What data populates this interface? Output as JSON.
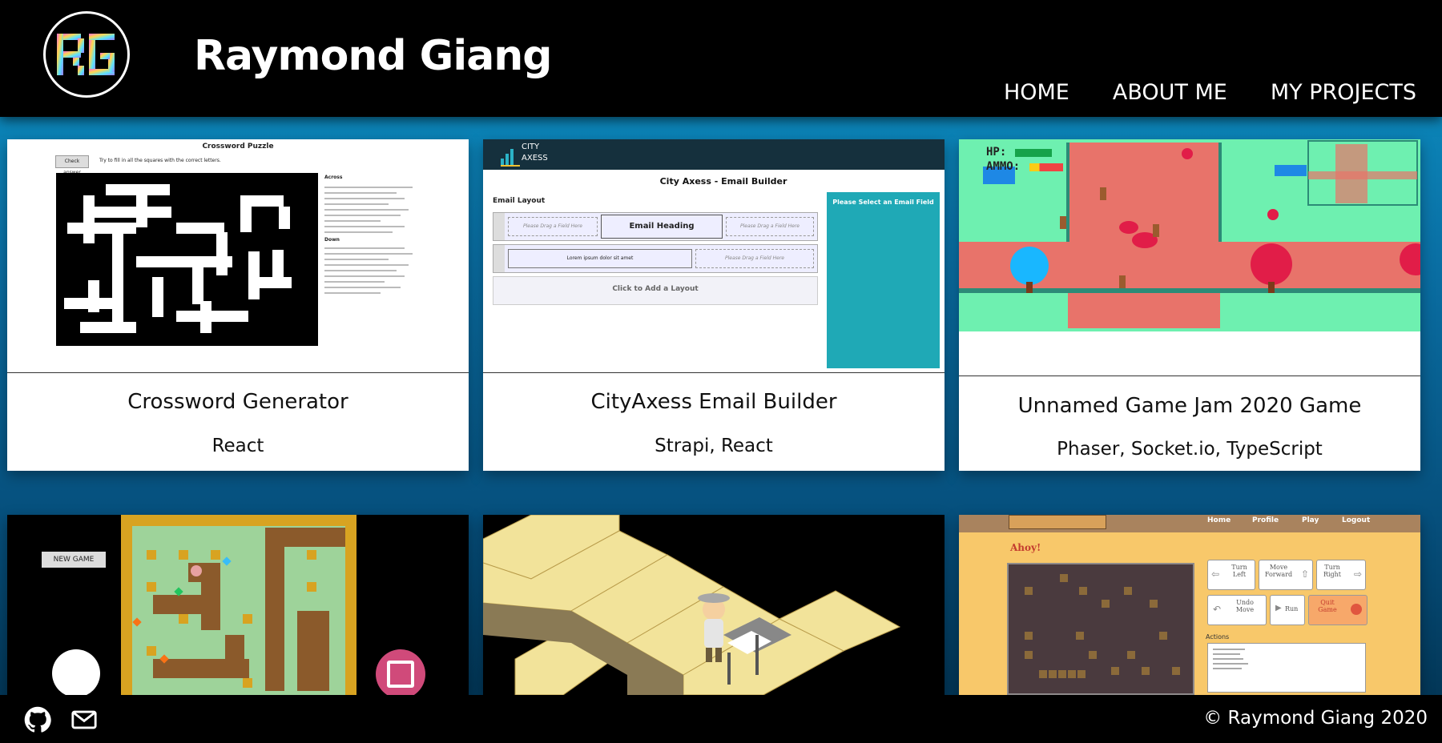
{
  "header": {
    "logo_text": "RG",
    "brand": "Raymond Giang",
    "nav": [
      "HOME",
      "ABOUT ME",
      "MY PROJECTS"
    ]
  },
  "projects": [
    {
      "title": "Crossword Generator",
      "tech": "React",
      "thumb": {
        "heading": "Crossword Puzzle",
        "button": "Check answer",
        "instruction": "Try to fill in all the squares with the correct letters.",
        "across_label": "Across",
        "down_label": "Down"
      }
    },
    {
      "title": "CityAxess Email Builder",
      "tech": "Strapi, React",
      "thumb": {
        "logo_top": "CITY",
        "logo_bottom": "AXESS",
        "heading": "City Axess - Email Builder",
        "section": "Email Layout",
        "email_heading": "Email Heading",
        "drop_field": "Please Drag a Field Here",
        "lorem": "Lorem ipsum dolor sit amet",
        "add_layout": "Click to Add a Layout",
        "select_field": "Please Select an Email Field"
      }
    },
    {
      "title": "Unnamed Game Jam 2020 Game",
      "tech": "Phaser, Socket.io, TypeScript",
      "thumb": {
        "hp": "HP:",
        "ammo": "AMMO:"
      }
    },
    {
      "title": "",
      "tech": "",
      "thumb": {
        "button": "NEW GAME"
      }
    },
    {
      "title": "",
      "tech": "",
      "thumb": {}
    },
    {
      "title": "",
      "tech": "",
      "thumb": {
        "nav": [
          "Home",
          "Profile",
          "Play",
          "Logout"
        ],
        "greeting": "Ahoy!",
        "turn_left": "Turn Left",
        "move_forward": "Move Forward",
        "turn_right": "Turn Right",
        "undo": "Undo Move",
        "run": "Run",
        "quit": "Quit Game",
        "actions": "Actions"
      }
    }
  ],
  "footer": {
    "copyright": "© Raymond Giang 2020"
  },
  "colors": {
    "header_bg": "#000000",
    "page_bg": "#0d96c8",
    "game_floor": "#e8736a",
    "game_grass": "#6ef0b0"
  },
  "icons": [
    "github-icon",
    "mail-icon"
  ]
}
